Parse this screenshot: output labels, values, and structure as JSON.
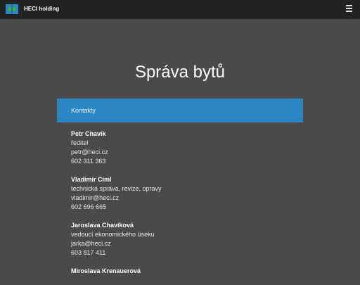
{
  "header": {
    "brand": "HECI holding",
    "logo_icon": "heci-logo-icon",
    "menu_icon": "hamburger-menu-icon",
    "colors": {
      "bar": "#222222",
      "logo_blue": "#2a87c4",
      "logo_green": "#3fae49"
    }
  },
  "page": {
    "title": "Správa bytů",
    "background": "#4a4a4a"
  },
  "section": {
    "label": "Kontakty",
    "color": "#2a87c4"
  },
  "contacts": [
    {
      "name": "Petr Chavík",
      "role": "ředitel",
      "email": "petr@heci.cz",
      "phone": "602 311 363"
    },
    {
      "name": "Vladimír Ciml",
      "role": "technická správa, revize, opravy",
      "email": "vladimir@heci.cz",
      "phone": "602 696 665"
    },
    {
      "name": "Jaroslava Chavíková",
      "role": "vedoucí ekonomického úseku",
      "email": "jarka@heci.cz",
      "phone": "603 817 411"
    },
    {
      "name": "Miroslava Krenauerová",
      "role": "",
      "email": "",
      "phone": ""
    }
  ]
}
